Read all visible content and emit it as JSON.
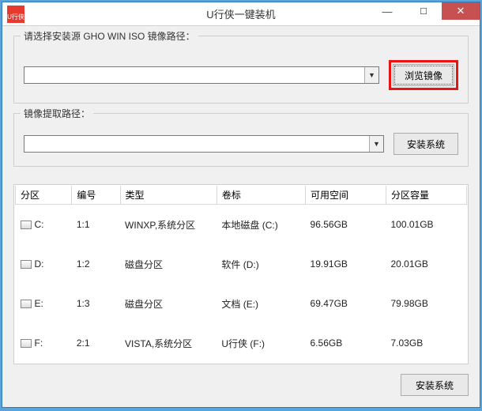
{
  "window": {
    "title": "U行侠一键装机",
    "icon_text": "U行侠"
  },
  "group_source": {
    "legend": "请选择安装源 GHO WIN ISO 镜像路径：",
    "browse_label": "浏览镜像",
    "combo_value": ""
  },
  "group_extract": {
    "legend": "镜像提取路径：",
    "install_label": "安装系统",
    "combo_value": ""
  },
  "table": {
    "headers": [
      "分区",
      "编号",
      "类型",
      "卷标",
      "可用空间",
      "分区容量"
    ],
    "rows": [
      {
        "drive": "C:",
        "num": "1:1",
        "type": "WINXP,系统分区",
        "label": "本地磁盘 (C:)",
        "free": "96.56GB",
        "cap": "100.01GB"
      },
      {
        "drive": "D:",
        "num": "1:2",
        "type": "磁盘分区",
        "label": "软件 (D:)",
        "free": "19.91GB",
        "cap": "20.01GB"
      },
      {
        "drive": "E:",
        "num": "1:3",
        "type": "磁盘分区",
        "label": "文档 (E:)",
        "free": "69.47GB",
        "cap": "79.98GB"
      },
      {
        "drive": "F:",
        "num": "2:1",
        "type": "VISTA,系统分区",
        "label": "U行侠 (F:)",
        "free": "6.56GB",
        "cap": "7.03GB"
      }
    ]
  },
  "footer": {
    "install_label": "安装系统"
  }
}
